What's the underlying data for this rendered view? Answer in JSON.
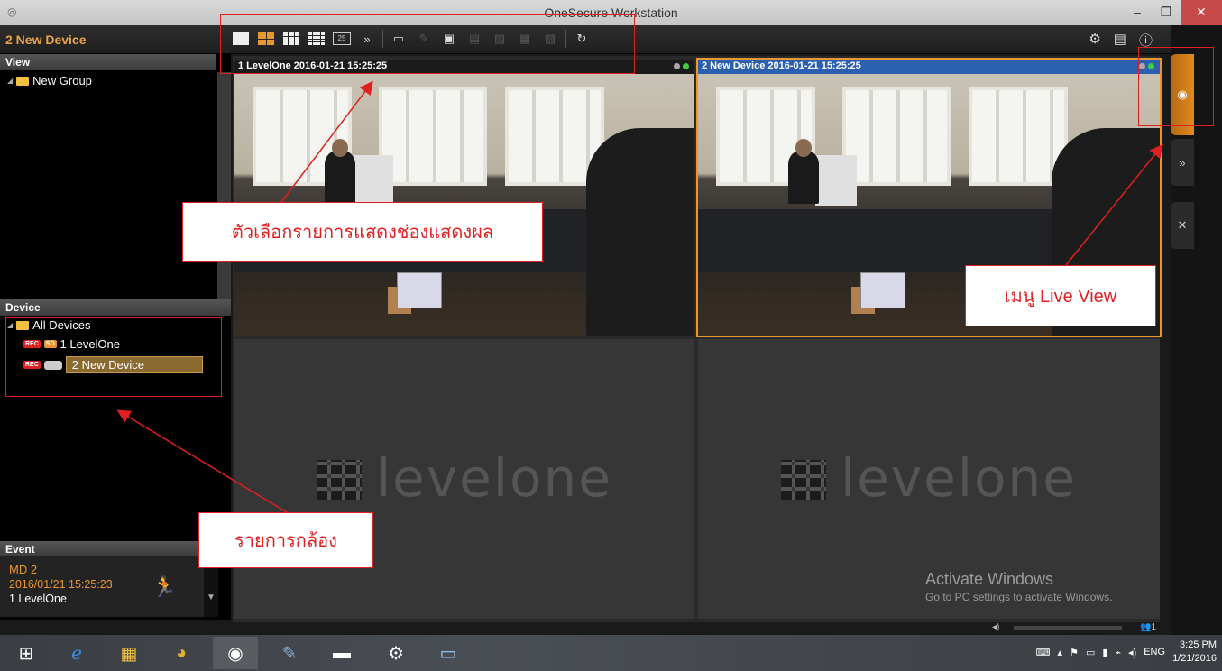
{
  "window": {
    "title": "OneSecure Workstation"
  },
  "app_bar": {
    "device_title": "2 New Device"
  },
  "left": {
    "view_header": "View",
    "view_group": "New Group",
    "device_header": "Device",
    "all_devices": "All Devices",
    "devices": [
      {
        "label": "1 LevelOne",
        "rec": "REC",
        "tag": "SD"
      },
      {
        "label": "2 New Device",
        "rec": "REC"
      }
    ],
    "event_header": "Event",
    "event": {
      "type": "MD 2",
      "time": "2016/01/21 15:25:23",
      "device": "1 LevelOne"
    }
  },
  "tiles": [
    {
      "header": "1 LevelOne  2016-01-21 15:25:25"
    },
    {
      "header": "2 New Device  2016-01-21 15:25:25"
    }
  ],
  "logo_text": "levelone",
  "watermark": {
    "line1": "Activate Windows",
    "line2": "Go to PC settings to activate Windows."
  },
  "status": {
    "users": "1"
  },
  "toolbar": {
    "layout25": "25",
    "more": "»"
  },
  "taskbar": {
    "lang": "ENG",
    "time": "3:25 PM",
    "date": "1/21/2016"
  },
  "annotations": {
    "layout_menu": "ตัวเลือกรายการแสดงช่องแสดงผล",
    "live_view": "เมนู Live View",
    "camera_list": "รายการกล้อง"
  },
  "colors": {
    "accent": "#e89830",
    "annotation": "#e02020",
    "active_header": "#2b5fb0"
  }
}
